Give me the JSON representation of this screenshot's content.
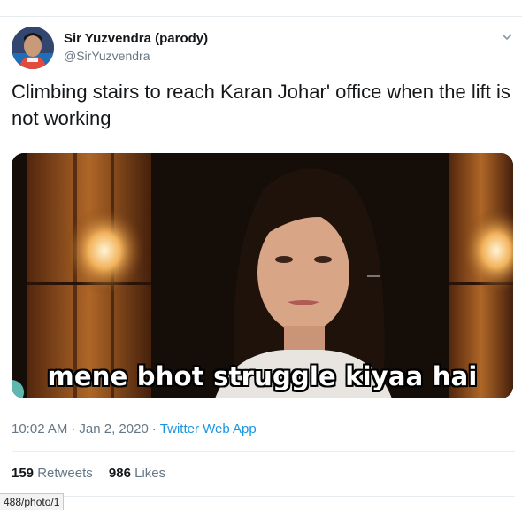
{
  "tweet": {
    "author_name": "Sir Yuzvendra (parody)",
    "author_handle": "@SirYuzvendra",
    "text": "Climbing stairs to reach Karan Johar' office when the lift is not working",
    "media_caption": "mene bhot struggle kiyaa hai",
    "time": "10:02 AM",
    "date": "Jan 2, 2020",
    "source_app": "Twitter Web App",
    "separator": "·"
  },
  "stats": {
    "retweets_count": "159",
    "retweets_label": "Retweets",
    "likes_count": "986",
    "likes_label": "Likes"
  },
  "browser": {
    "status_url": "488/photo/1"
  },
  "icons": {
    "caret": "chevron-down-icon"
  }
}
